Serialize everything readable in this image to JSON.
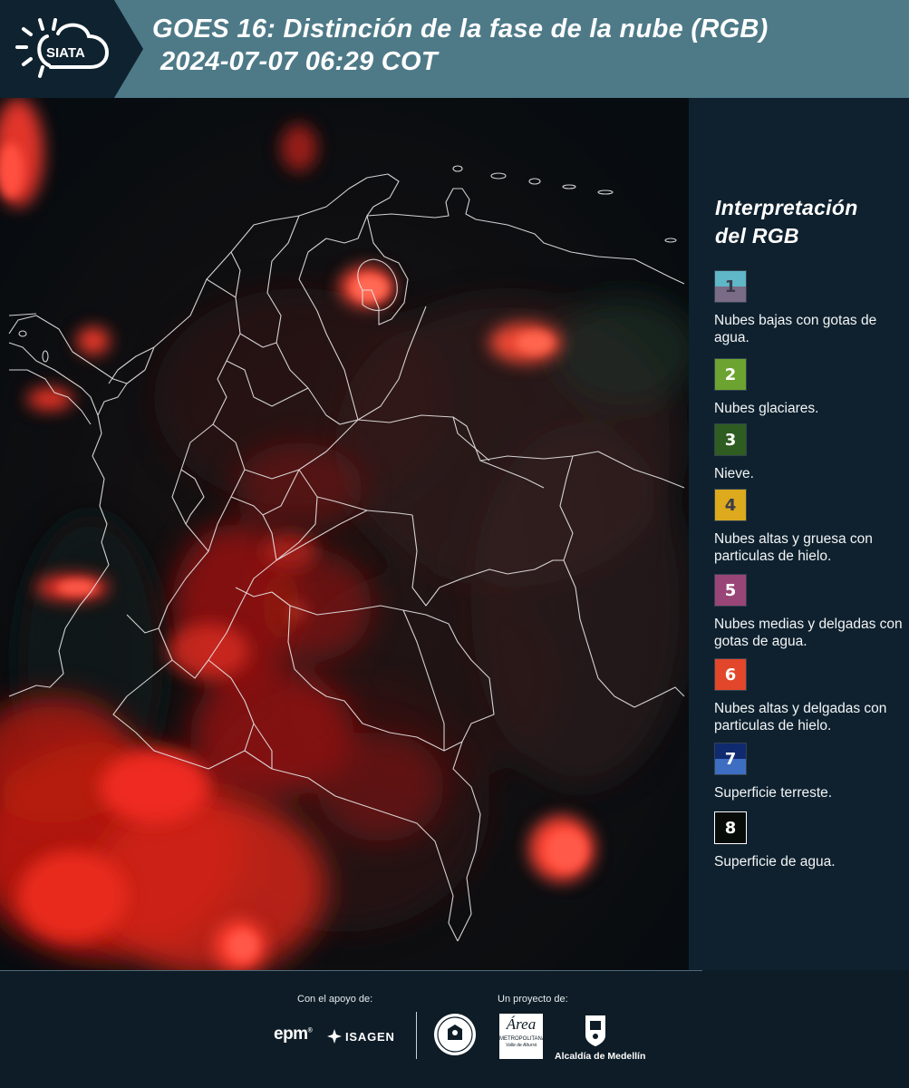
{
  "header": {
    "title_line1": "GOES 16: Distinción de la fase de la nube (RGB)",
    "title_line2": "2024-07-07 06:29 COT",
    "logo_text": "SIATA"
  },
  "legend": {
    "title_line1": "Interpretación",
    "title_line2": "del RGB",
    "items": [
      {
        "num": "1",
        "label": "Nubes bajas con gotas de agua.",
        "color_top": "#5fb7c8",
        "color_bottom": "#7a6b86",
        "num_color": "#3b3b4a"
      },
      {
        "num": "2",
        "label": "Nubes glaciares.",
        "color_top": "#6ca331",
        "color_bottom": "#6ca331",
        "num_color": "#ffffff"
      },
      {
        "num": "3",
        "label": "Nieve.",
        "color_top": "#2f5c20",
        "color_bottom": "#2f5c20",
        "num_color": "#ffffff"
      },
      {
        "num": "4",
        "label": "Nubes altas y gruesa con particulas de hielo.",
        "color_top": "#dcaa1c",
        "color_bottom": "#dcaa1c",
        "num_color": "#3b3b4a"
      },
      {
        "num": "5",
        "label": "Nubes medias y delgadas con gotas de agua.",
        "color_top": "#9a4577",
        "color_bottom": "#9a4577",
        "num_color": "#ffffff"
      },
      {
        "num": "6",
        "label": "Nubes altas y delgadas con particulas de hielo.",
        "color_top": "#e2472b",
        "color_bottom": "#e2472b",
        "num_color": "#ffffff"
      },
      {
        "num": "7",
        "label": "Superficie terreste.",
        "color_top": "#0f2a6e",
        "color_bottom": "#3e6ec2",
        "num_color": "#ffffff"
      },
      {
        "num": "8",
        "label": "Superficie de agua.",
        "color_top": "#070c08",
        "color_bottom": "#070c08",
        "num_color": "#ffffff"
      }
    ]
  },
  "footer": {
    "support_label": "Con el apoyo de:",
    "project_label": "Un proyecto de:",
    "logos": [
      "epm",
      "ISAGEN",
      "Area Metropolitana",
      "Alcaldía de Medellín"
    ],
    "epm_text": "epm",
    "isagen_text": "ISAGEN",
    "area_text": "Área",
    "area_sub": "METROPOLITANA",
    "area_sub2": "Valle de Aburrá",
    "alcaldia_text": "Alcaldía de Medellín"
  }
}
